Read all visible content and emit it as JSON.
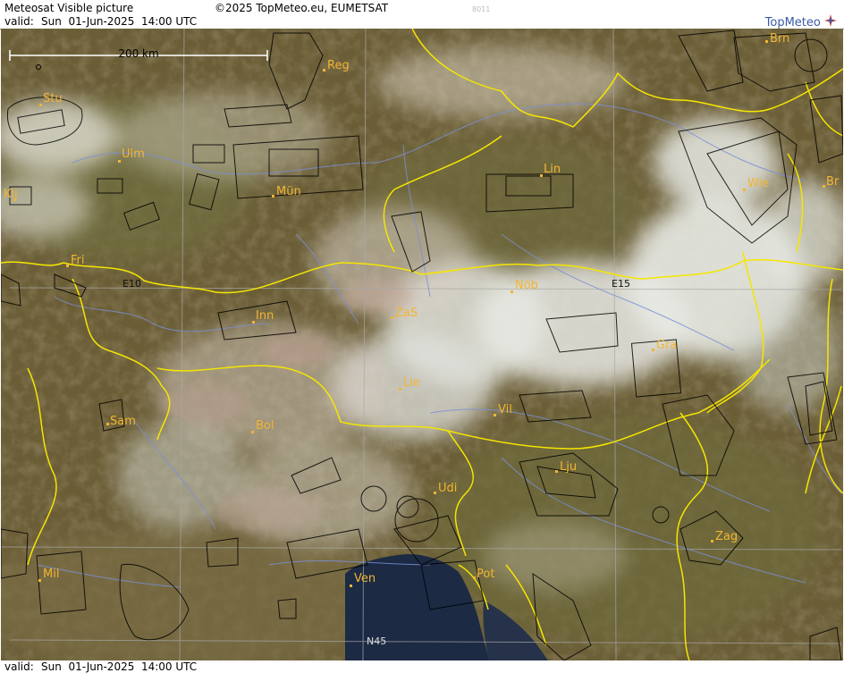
{
  "header": {
    "title": "Meteosat Visible picture",
    "copyright": "©2025 TopMeteo.eu, EUMETSAT",
    "code": "8011",
    "valid_label": "valid:",
    "valid_time": "Sun  01-Jun-2025  14:00 UTC",
    "logo": "TopMeteo"
  },
  "footer": {
    "valid_label": "valid:",
    "valid_time": "Sun  01-Jun-2025  14:00 UTC"
  },
  "map": {
    "scale_label": "200 km",
    "grid_labels": {
      "lon10": "E10",
      "lon15": "E15",
      "lat45": "N45"
    },
    "colors": {
      "border": "#f5e600",
      "city": "#f2b533",
      "grid": "#a0a0a0",
      "airspace": "#000000",
      "rivers": "#7b8fd6"
    },
    "cities": [
      {
        "name": "Reg"
      },
      {
        "name": "Brn"
      },
      {
        "name": "Stu"
      },
      {
        "name": "Ulm"
      },
      {
        "name": "Mün"
      },
      {
        "name": "Lin"
      },
      {
        "name": "Wie"
      },
      {
        "name": "Br"
      },
      {
        "name": "Kli"
      },
      {
        "name": "Fri"
      },
      {
        "name": "Nöb"
      },
      {
        "name": "Inn"
      },
      {
        "name": "ZaS"
      },
      {
        "name": "Gra"
      },
      {
        "name": "Lie"
      },
      {
        "name": "Vil"
      },
      {
        "name": "Sam"
      },
      {
        "name": "Bol"
      },
      {
        "name": "Lju"
      },
      {
        "name": "Udi"
      },
      {
        "name": "Zag"
      },
      {
        "name": "Mil"
      },
      {
        "name": "Ven"
      },
      {
        "name": "Pot"
      }
    ]
  }
}
